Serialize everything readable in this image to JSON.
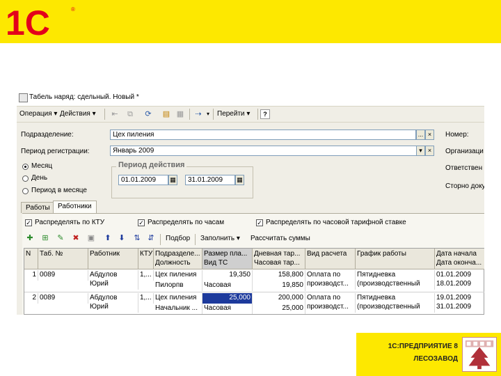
{
  "logo": {
    "text": "1С",
    "mark": "®"
  },
  "window": {
    "title": "Табель наряд: сдельный. Новый *",
    "menu": {
      "operation": "Операция ▾",
      "actions": "Действия ▾",
      "goto": "Перейти ▾",
      "help": "?"
    },
    "form": {
      "division_label": "Подразделение:",
      "division_value": "Цех пиления",
      "period_label": "Период регистрации:",
      "period_value": "Январь 2009",
      "number_label": "Номер:",
      "org_label": "Организаци",
      "resp_label": "Ответствен",
      "storno_label": "Сторно доку",
      "radio_month": "Месяц",
      "radio_day": "День",
      "radio_period": "Период в месяце",
      "group_title": "Период действия",
      "date_from": "01.01.2009",
      "date_to": "31.01.2009",
      "btn_dots": "...",
      "btn_clear": "×",
      "btn_drop": "▾"
    },
    "tabs": [
      "Работы",
      "Работники"
    ],
    "checks": {
      "c1": "Распределять по КТУ",
      "c2": "Распределять по часам",
      "c3": "Распределять по часовой тарифной ставке"
    },
    "grid_toolbar": {
      "pick": "Подбор",
      "fill": "Заполнить ▾",
      "calc": "Рассчитать суммы"
    },
    "columns": [
      {
        "l1": "N",
        "l2": ""
      },
      {
        "l1": "Таб. №",
        "l2": ""
      },
      {
        "l1": "Работник",
        "l2": ""
      },
      {
        "l1": "КТУ",
        "l2": ""
      },
      {
        "l1": "Подразделе...",
        "l2": "Должность"
      },
      {
        "l1": "Размер пла...",
        "l2": "Вид ТС"
      },
      {
        "l1": "Дневная тар...",
        "l2": "Часовая тар..."
      },
      {
        "l1": "Вид расчета",
        "l2": ""
      },
      {
        "l1": "График работы",
        "l2": ""
      },
      {
        "l1": "Дата начала",
        "l2": "Дата оконча..."
      }
    ],
    "rows": [
      {
        "n": "1",
        "tab": "0089",
        "worker1": "Абдулов",
        "worker2": "Юрий",
        "ktu": "1,...",
        "div": "Цех пиления",
        "pos": "Пилорпв",
        "size": "19,350",
        "ts": "Часовая",
        "day": "158,800",
        "hour": "19,850",
        "calc1": "Оплата по",
        "calc2": "производст...",
        "sch1": "Пятидневка",
        "sch2": "(производственный",
        "d1": "01.01.2009",
        "d2": "18.01.2009"
      },
      {
        "n": "2",
        "tab": "0089",
        "worker1": "Абдулов",
        "worker2": "Юрий",
        "ktu": "1,...",
        "div": "Цех пиления",
        "pos": "Начальник ...",
        "size": "25,000",
        "ts": "Часовая",
        "day": "200,000",
        "hour": "25,000",
        "calc1": "Оплата по",
        "calc2": "производст...",
        "sch1": "Пятидневка",
        "sch2": "(производственный",
        "d1": "19.01.2009",
        "d2": "31.01.2009"
      }
    ]
  },
  "brand": {
    "line1": "1С:ПРЕДПРИЯТИЕ 8",
    "line2": "ЛЕСОЗАВОД"
  },
  "colors": {
    "yellow": "#fde800",
    "logo_red": "#e3001b",
    "selection": "#1d3a9c"
  }
}
